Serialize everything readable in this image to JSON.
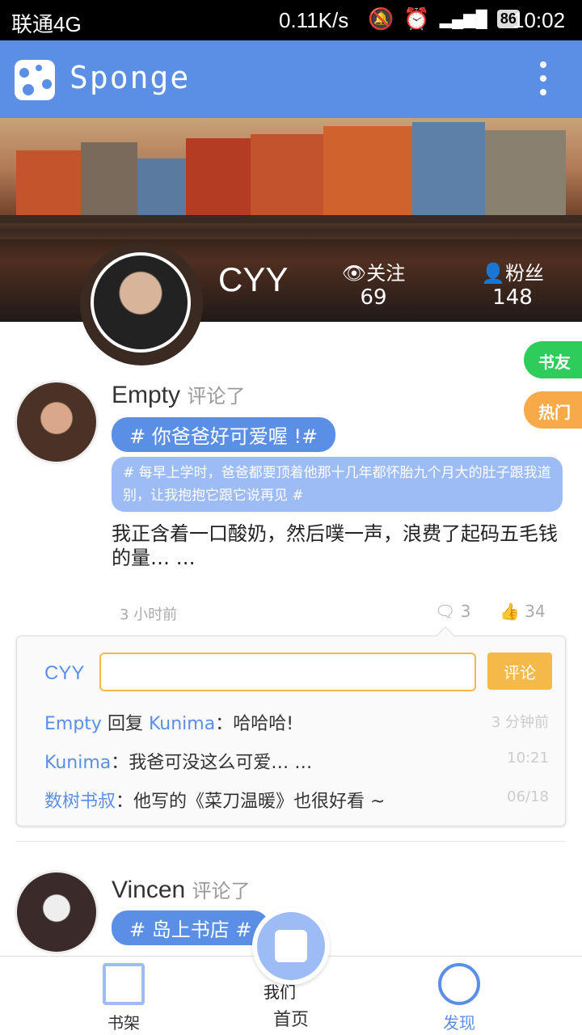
{
  "status_bar": {
    "carrier": "联通4G",
    "speed": "0.11K/s",
    "battery": "86",
    "time": "10:02"
  },
  "app_bar": {
    "title": "Sponge"
  },
  "profile": {
    "name": "CYY",
    "follow_label": "关注",
    "follow_count": "69",
    "fans_label": "粉丝",
    "fans_count": "148"
  },
  "side_tabs": {
    "friends": "书友",
    "hot": "热门"
  },
  "post1": {
    "user": "Empty",
    "verb": "评论了",
    "tag": "# 你爸爸好可爱喔 !#",
    "quote": "# 每早上学时，爸爸都要顶着他那十几年都怀胎九个月大的肚子跟我道别，让我抱抱它跟它说再见 #",
    "text": "我正含着一口酸奶，然后噗一声，浪费了起码五毛钱的量… …",
    "time": "3 小时前",
    "comments": "3",
    "likes": "34"
  },
  "comment_box": {
    "user": "CYY",
    "input_value": "",
    "submit_label": "评论",
    "replies": [
      {
        "user": "Empty",
        "mid": "回复",
        "target": "Kunima",
        "text": "：哈哈哈!",
        "time": "3 分钟前"
      },
      {
        "user": "Kunima",
        "text": "：我爸可没这么可爱… …",
        "time": "10:21"
      },
      {
        "user": "数树书叔",
        "text": "：他写的《菜刀温暖》也很好看 ~",
        "time": "06/18"
      }
    ]
  },
  "post2": {
    "user": "Vincen",
    "verb": "评论了",
    "tag": "# 岛上书店 #",
    "text_partial": "我们"
  },
  "tab_bar": {
    "shelf": "书架",
    "home": "首页",
    "discover": "发现"
  },
  "colors": {
    "primary": "#5b8fe6",
    "accent": "#f5b94a",
    "green": "#2ecc5a",
    "orange": "#f8a94a"
  }
}
